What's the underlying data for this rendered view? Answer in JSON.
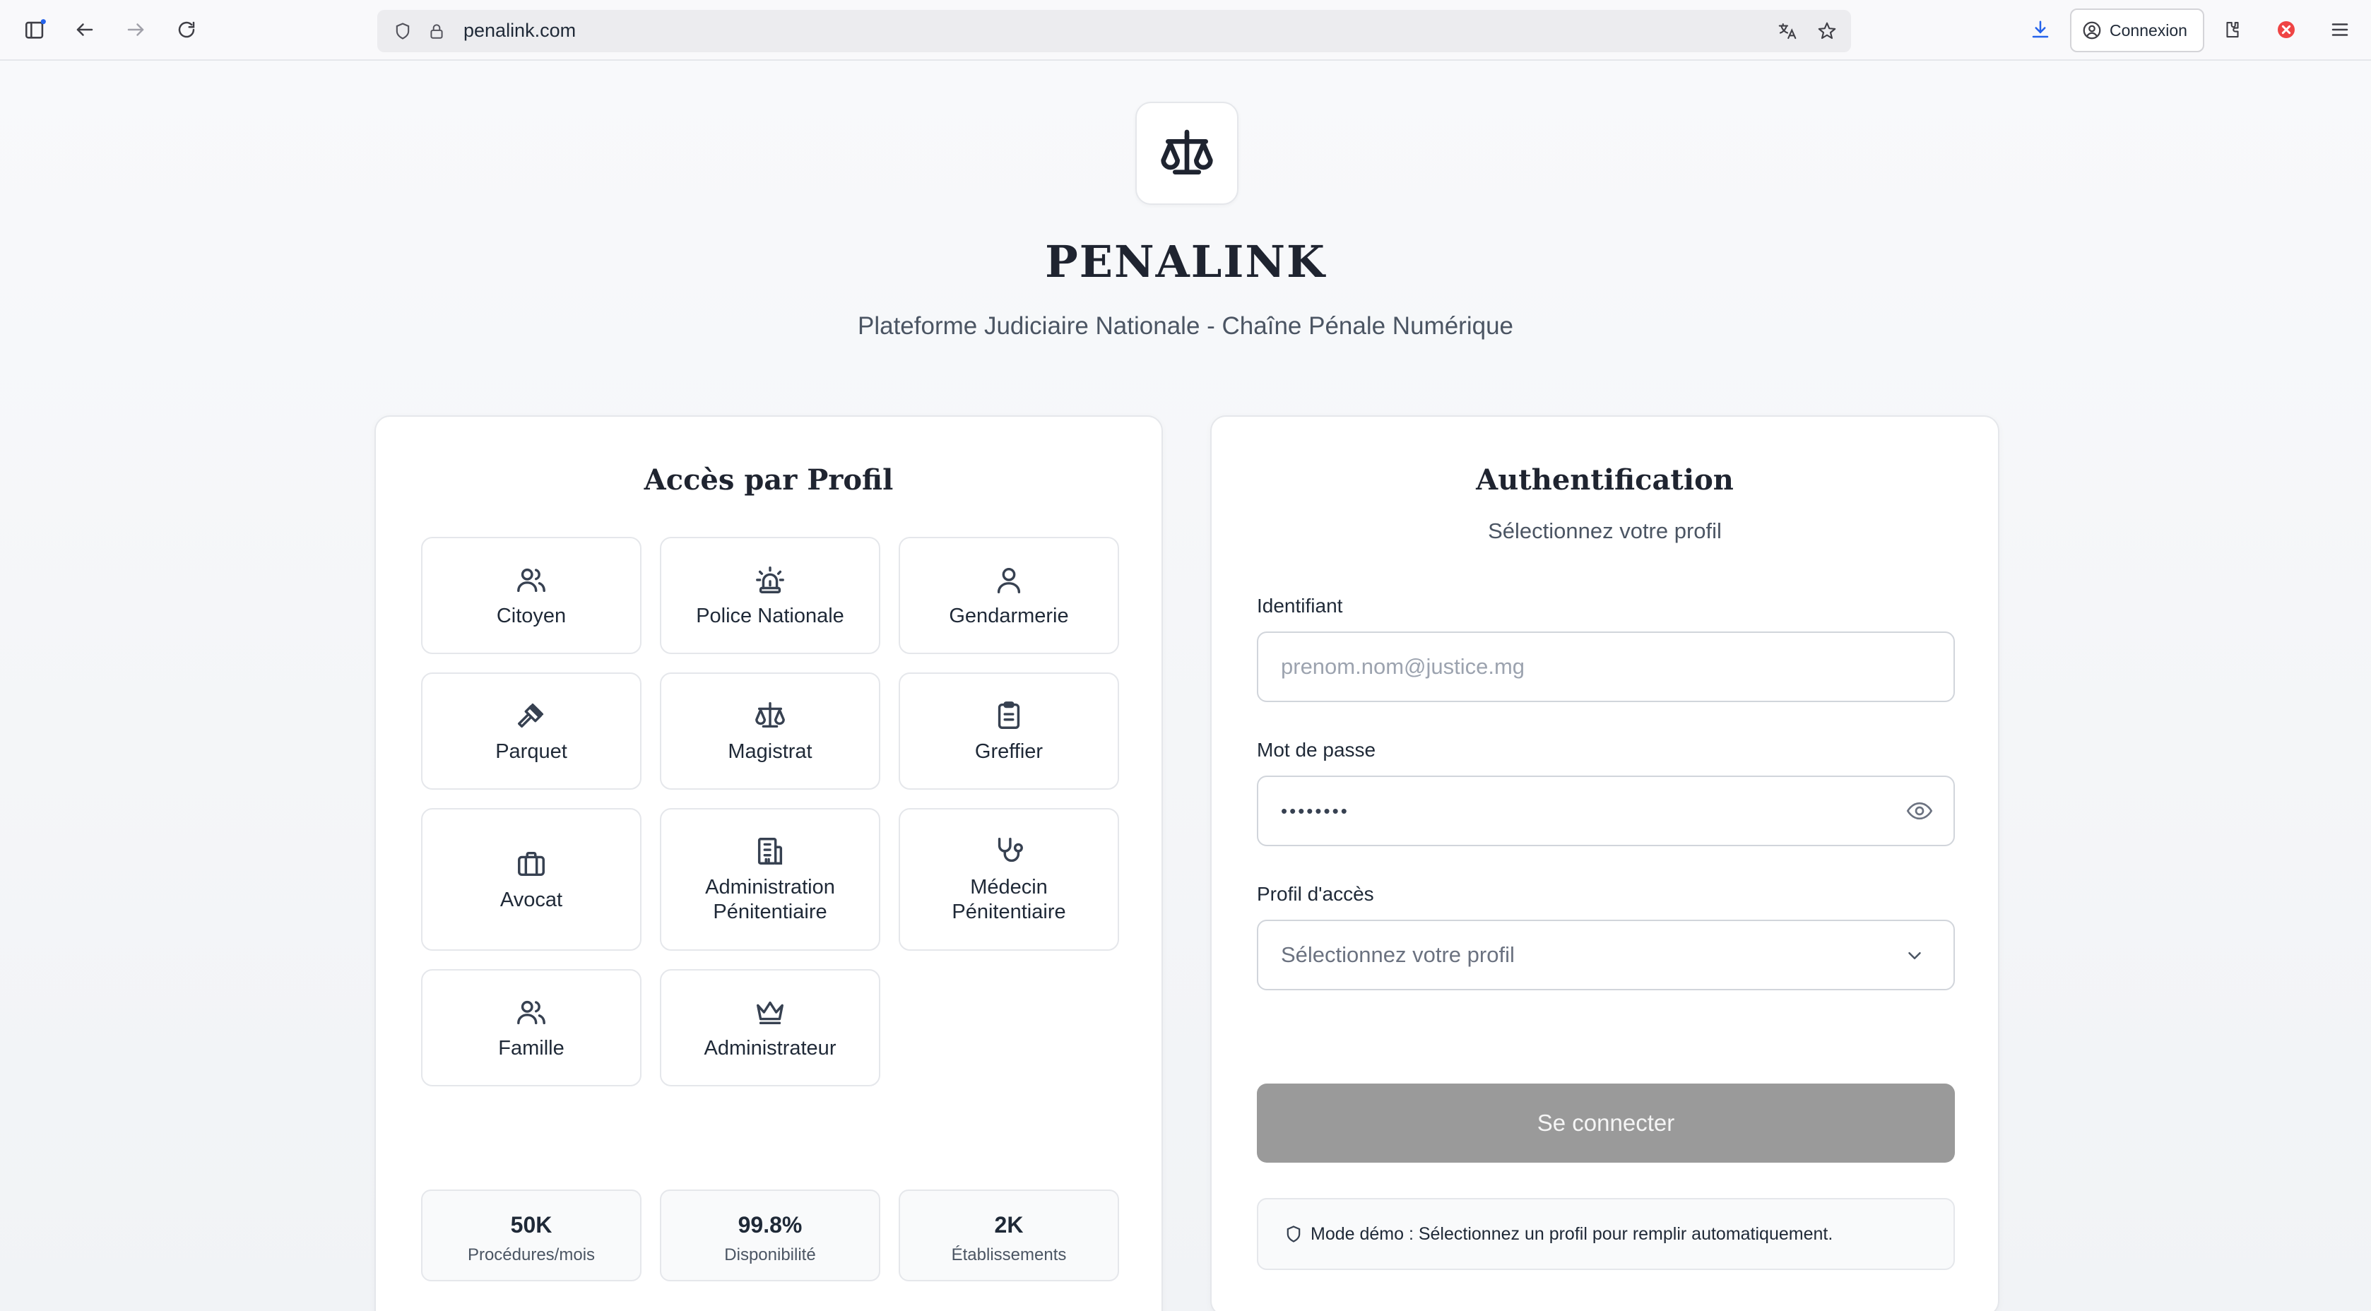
{
  "browser": {
    "url": "penalink.com",
    "account_button_label": "Connexion"
  },
  "header": {
    "brand": "PENALINK",
    "tagline": "Plateforme Judiciaire Nationale - Chaîne Pénale Numérique"
  },
  "profiles_panel": {
    "title": "Accès par Profil",
    "profiles": [
      {
        "label": "Citoyen",
        "icon": "users-icon"
      },
      {
        "label": "Police Nationale",
        "icon": "siren-icon"
      },
      {
        "label": "Gendarmerie",
        "icon": "user-icon"
      },
      {
        "label": "Parquet",
        "icon": "gavel-icon"
      },
      {
        "label": "Magistrat",
        "icon": "scale-icon"
      },
      {
        "label": "Greffier",
        "icon": "clipboard-icon"
      },
      {
        "label": "Avocat",
        "icon": "briefcase-icon"
      },
      {
        "label": "Administration Pénitentiaire",
        "icon": "building-icon"
      },
      {
        "label": "Médecin Pénitentiaire",
        "icon": "stethoscope-icon"
      },
      {
        "label": "Famille",
        "icon": "users-icon"
      },
      {
        "label": "Administrateur",
        "icon": "crown-icon"
      }
    ],
    "stats": [
      {
        "value": "50K",
        "label": "Procédures/mois"
      },
      {
        "value": "99.8%",
        "label": "Disponibilité"
      },
      {
        "value": "2K",
        "label": "Établissements"
      }
    ]
  },
  "auth_panel": {
    "title": "Authentification",
    "subtitle": "Sélectionnez votre profil",
    "identifier_label": "Identifiant",
    "identifier_placeholder": "prenom.nom@justice.mg",
    "password_label": "Mot de passe",
    "password_value": "••••••••",
    "profile_label": "Profil d'accès",
    "profile_placeholder": "Sélectionnez votre profil",
    "submit_label": "Se connecter",
    "demo_note": "Mode démo : Sélectionnez un profil pour remplir automatiquement."
  },
  "colors": {
    "accent_dark": "#1f2430",
    "button_disabled": "#9a9a9a",
    "border": "#e5e7eb"
  }
}
